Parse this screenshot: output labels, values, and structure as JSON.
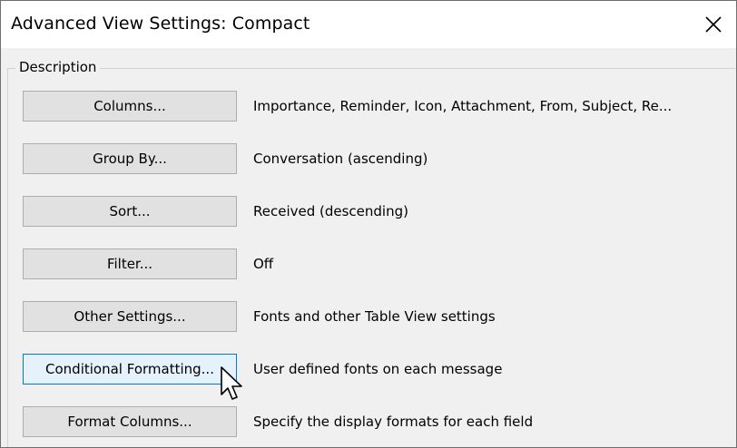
{
  "dialog": {
    "title": "Advanced View Settings: Compact",
    "close_icon": "close-icon"
  },
  "description_group": {
    "legend": "Description"
  },
  "rows": [
    {
      "button_label": "Columns...",
      "description": "Importance, Reminder, Icon, Attachment, From, Subject, Re..."
    },
    {
      "button_label": "Group By...",
      "description": "Conversation (ascending)"
    },
    {
      "button_label": "Sort...",
      "description": "Received (descending)"
    },
    {
      "button_label": "Filter...",
      "description": "Off"
    },
    {
      "button_label": "Other Settings...",
      "description": "Fonts and other Table View settings"
    },
    {
      "button_label": "Conditional Formatting...",
      "description": "User defined fonts on each message",
      "state": "hover"
    },
    {
      "button_label": "Format Columns...",
      "description": "Specify the display formats for each field"
    }
  ],
  "colors": {
    "button_bg": "#e1e1e1",
    "button_border": "#adadad",
    "button_hover_bg": "#e5f1fb",
    "button_hover_border": "#0078d7",
    "dialog_bg": "#f0f0f0",
    "titlebar_bg": "#ffffff"
  },
  "pointer": "mouse-pointer-icon"
}
